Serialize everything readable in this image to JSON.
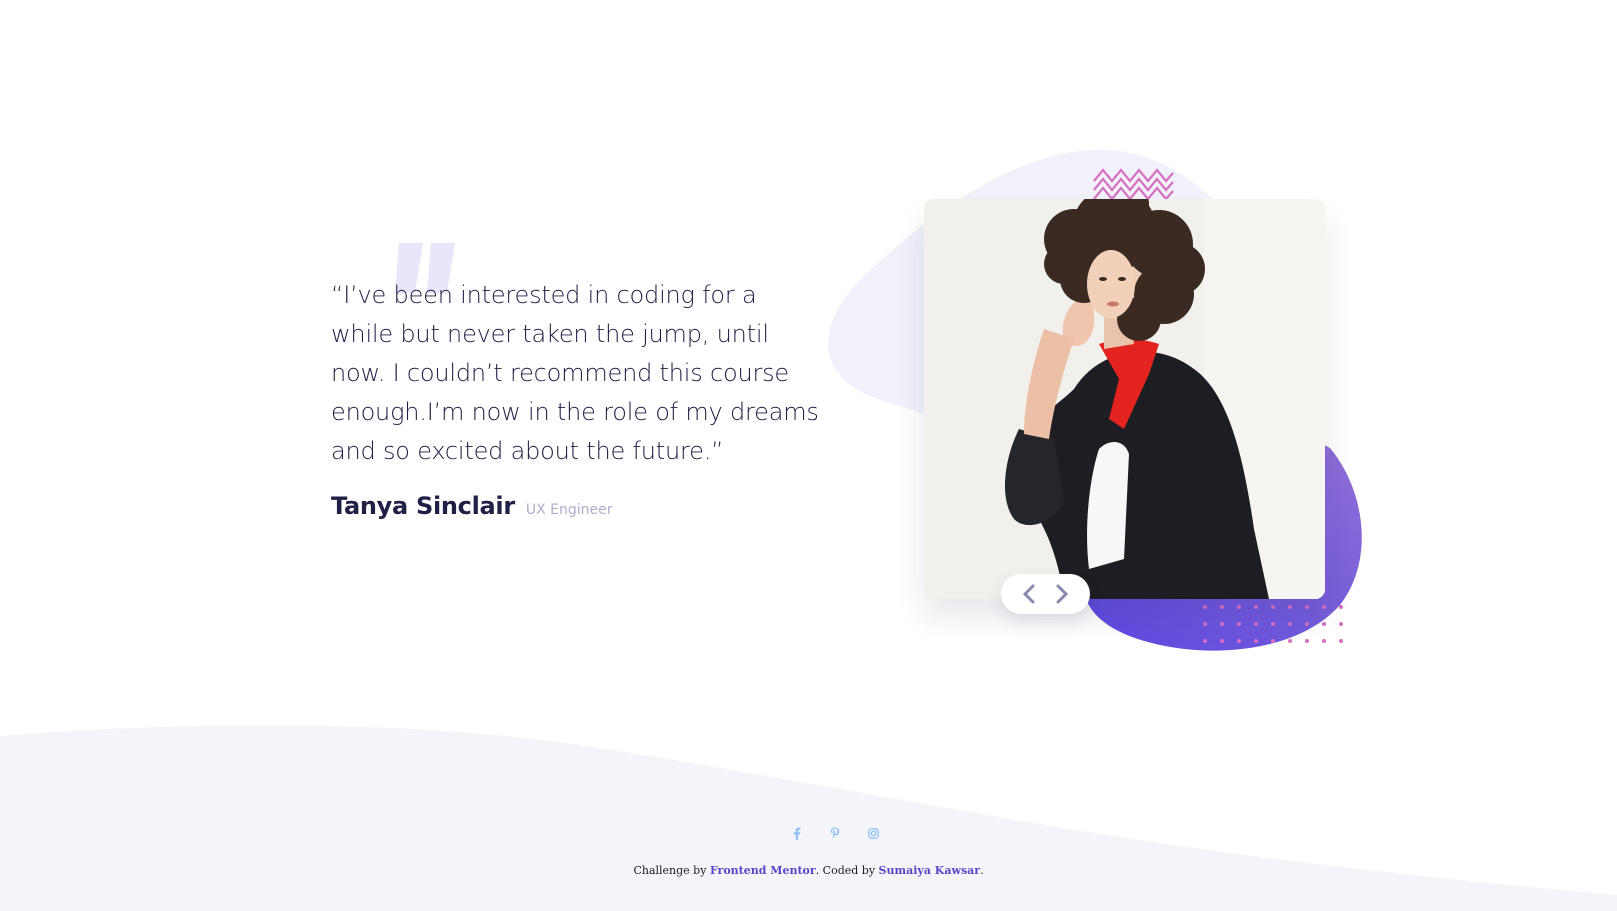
{
  "testimonial": {
    "quote": "“I’ve been interested in coding for a while but never taken the jump, until now. I couldn’t recommend this course enough.I’m now in the role of my dreams and so excited about the future.”",
    "name": "Tanya Sinclair",
    "role": "UX Engineer"
  },
  "photo": {
    "alt": "Tanya Sinclair"
  },
  "navigation": {
    "prev_icon": "chevron-left-icon",
    "next_icon": "chevron-right-icon"
  },
  "socials": [
    {
      "icon": "facebook-icon"
    },
    {
      "icon": "pinterest-icon"
    },
    {
      "icon": "instagram-icon"
    }
  ],
  "footer": {
    "challenge_prefix": "Challenge by ",
    "challenge_link": "Frontend Mentor",
    "coded_prefix": ". Coded by ",
    "author_link": "Sumaiya Kawsar",
    "suffix": "."
  },
  "colors": {
    "text_dark": "#202046",
    "text_muted": "#b0adcc",
    "accent_purple": "#5a45c7",
    "soft_background": "#f4f4fb",
    "blob_gradient_start": "#5b48e0",
    "blob_gradient_end": "#8e6fd6",
    "pattern_pink": "#d770c2",
    "social_blue": "#8fc2f3"
  }
}
